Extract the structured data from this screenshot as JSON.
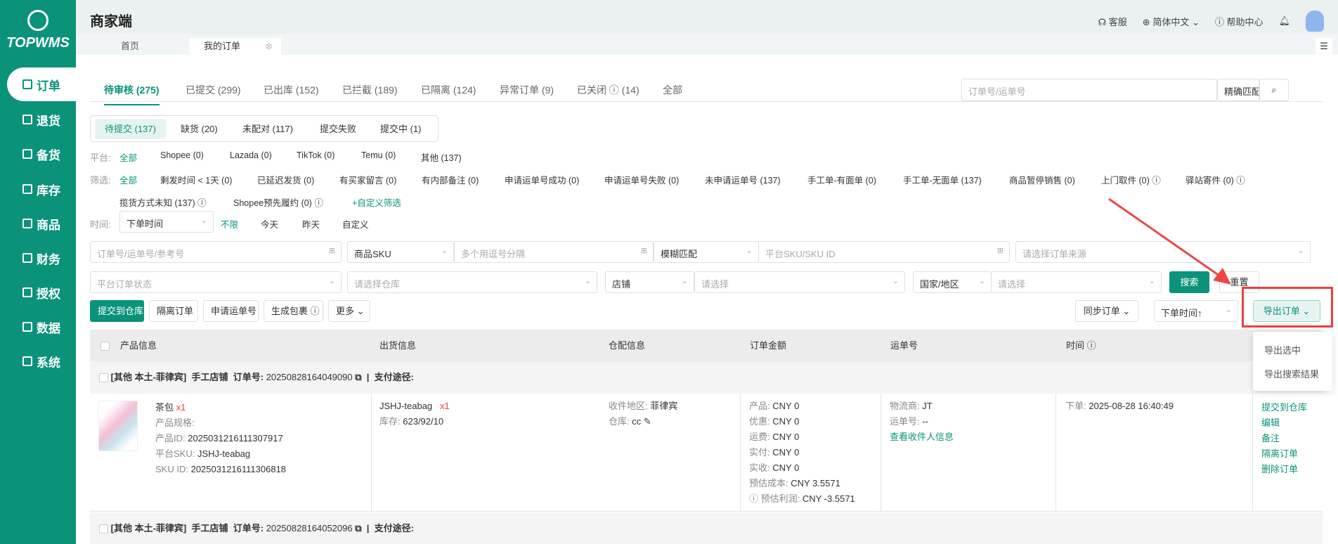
{
  "app": {
    "logo": "TOPWMS",
    "title": "商家端"
  },
  "sidebar": {
    "items": [
      {
        "label": "订单"
      },
      {
        "label": "退货"
      },
      {
        "label": "备货"
      },
      {
        "label": "库存"
      },
      {
        "label": "商品"
      },
      {
        "label": "财务"
      },
      {
        "label": "授权"
      },
      {
        "label": "数据"
      },
      {
        "label": "系统"
      }
    ]
  },
  "topbar": {
    "service": "客服",
    "language": "简体中文",
    "help": "帮助中心"
  },
  "page_tabs": [
    {
      "label": "首页"
    },
    {
      "label": "我的订单"
    }
  ],
  "status_tabs": [
    {
      "label": "待审核 (275)"
    },
    {
      "label": "已提交 (299)"
    },
    {
      "label": "已出库 (152)"
    },
    {
      "label": "已拦截 (189)"
    },
    {
      "label": "已隔离 (124)"
    },
    {
      "label": "异常订单 (9)"
    },
    {
      "label": "已关闭 ⓘ (14)"
    },
    {
      "label": "全部"
    }
  ],
  "quick_search": {
    "placeholder": "订单号/运单号",
    "match": "精确匹配"
  },
  "sub_tabs": [
    {
      "label": "待提交 (137)"
    },
    {
      "label": "缺货 (20)"
    },
    {
      "label": "未配对 (117)"
    },
    {
      "label": "提交失败"
    },
    {
      "label": "提交中 (1)"
    }
  ],
  "platform": {
    "label": "平台:",
    "items": [
      "全部",
      "Shopee (0)",
      "Lazada (0)",
      "TikTok (0)",
      "Temu (0)",
      "其他 (137)"
    ]
  },
  "filter": {
    "label": "筛选:",
    "items": [
      "全部",
      "剩发时间 < 1天 (0)",
      "已延迟发货 (0)",
      "有买家留言 (0)",
      "有内部备注 (0)",
      "申请运单号成功 (0)",
      "申请运单号失败 (0)",
      "未申请运单号 (137)",
      "手工单-有面单 (0)",
      "手工单-无面单 (137)",
      "商品暂停销售 (0)",
      "上门取件 (0) ⓘ",
      "驿站寄件 (0) ⓘ"
    ],
    "row2": [
      "揽货方式未知 (137) ⓘ",
      "Shopee预先履约 (0) ⓘ"
    ],
    "custom": "+自定义筛选"
  },
  "time": {
    "label": "时间:",
    "select": "下单时间",
    "items": [
      "不限",
      "今天",
      "昨天",
      "自定义"
    ]
  },
  "search": {
    "order_ph": "订单号/运单号/参考号",
    "sku_type": "商品SKU",
    "sku_ph": "多个用逗号分隔",
    "fuzzy": "模糊匹配",
    "platform_sku_ph": "平台SKU/SKU ID",
    "source_ph": "请选择订单来源",
    "status_ph": "平台订单状态",
    "warehouse_ph": "请选择仓库",
    "shop": "店铺",
    "shop_ph": "请选择",
    "country": "国家/地区",
    "country_ph": "请选择",
    "search_btn": "搜索",
    "reset_btn": "重置"
  },
  "actions": {
    "submit": "提交到仓库",
    "isolate": "隔离订单",
    "apply": "申请运单号",
    "package": "生成包裹 ⓘ",
    "more": "更多",
    "sync": "同步订单",
    "sort": "下单时间↑",
    "export": "导出订单"
  },
  "export_menu": [
    "导出选中",
    "导出搜索结果"
  ],
  "table": {
    "headers": [
      "产品信息",
      "出货信息",
      "仓配信息",
      "订单金额",
      "运单号",
      "时间"
    ],
    "orders": [
      {
        "group": "[其他 本土-菲律宾]",
        "shop": "手工店铺",
        "order_label": "订单号:",
        "order_no": "20250828164049090",
        "pay_label": "支付途径:",
        "product": {
          "name": "茶包",
          "qty": "x1",
          "spec": "产品规格:",
          "id_label": "产品ID:",
          "id": "2025031216111307917",
          "psku_label": "平台SKU:",
          "psku": "JSHJ-teabag",
          "skuid_label": "SKU ID:",
          "skuid": "2025031216111306818"
        },
        "ship": {
          "sku": "JSHJ-teabag",
          "qty": "x1",
          "stock_label": "库存:",
          "stock": "623/92/10"
        },
        "wh": {
          "region_label": "收件地区:",
          "region": "菲律宾",
          "wh_label": "仓库:",
          "wh": "cc"
        },
        "amount": [
          [
            "产品:",
            "CNY 0"
          ],
          [
            "优惠:",
            "CNY 0"
          ],
          [
            "运费:",
            "CNY 0"
          ],
          [
            "实付:",
            "CNY 0"
          ],
          [
            "实收:",
            "CNY 0"
          ],
          [
            "预估成本:",
            "CNY 3.5571"
          ],
          [
            "ⓘ 预估利润:",
            "CNY -3.5571"
          ]
        ],
        "waybill": {
          "carrier_label": "物流商:",
          "carrier": "JT",
          "no_label": "运单号:",
          "no": "--",
          "link": "查看收件人信息"
        },
        "time": {
          "label": "下单:",
          "value": "2025-08-28 16:40:49"
        },
        "ops": [
          "提交到仓库",
          "编辑",
          "备注",
          "隔离订单",
          "删除订单"
        ]
      },
      {
        "group": "[其他 本土-菲律宾]",
        "shop": "手工店铺",
        "order_label": "订单号:",
        "order_no": "20250828164052096",
        "pay_label": "支付途径:"
      }
    ]
  }
}
